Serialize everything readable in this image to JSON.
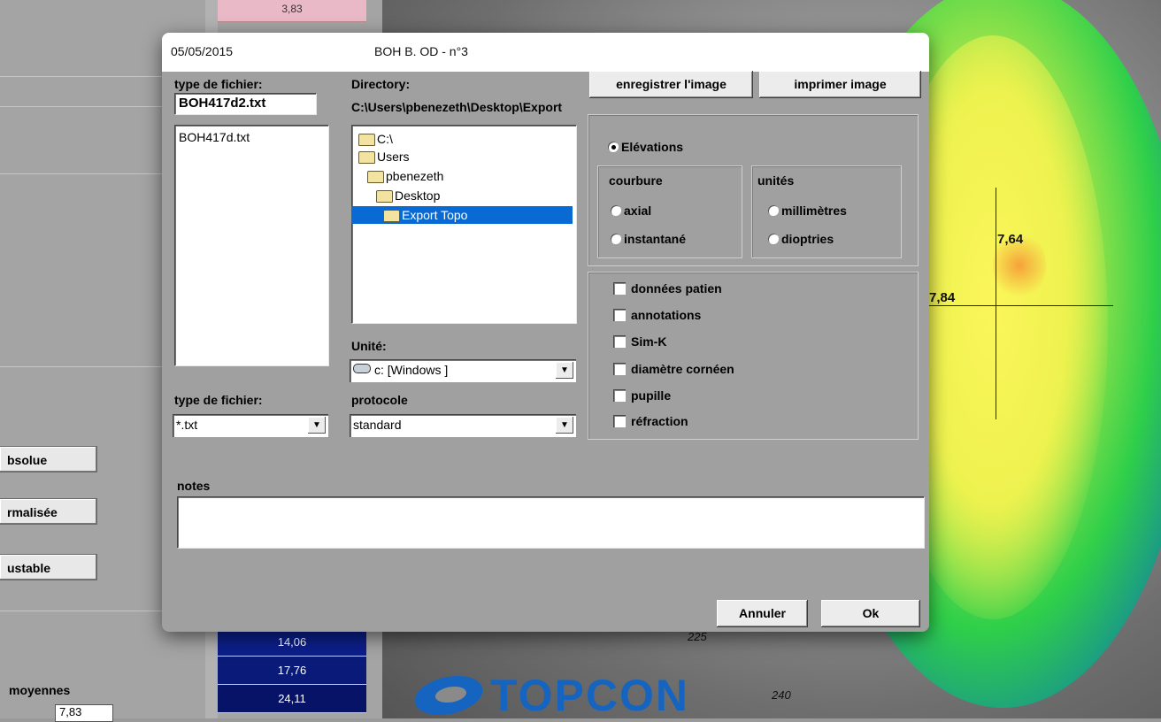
{
  "background": {
    "top_value": "3,83",
    "left_buttons": [
      "bsolue",
      "rmalisée",
      "ustable"
    ],
    "value_cells": [
      {
        "text": "14,06",
        "color": "#0c1f8a"
      },
      {
        "text": "17,76",
        "color": "#0a1a78"
      },
      {
        "text": "24,11",
        "color": "#071366"
      }
    ],
    "moyennes_label": "moyennes",
    "moyennes_value": "7,83",
    "map_values": {
      "upper": "7,64",
      "left": "7,84"
    },
    "compass_labels": {
      "a": "225",
      "b": "240"
    },
    "logo_text": "TOPCON",
    "logo_color": "#1565c0"
  },
  "dialog": {
    "title_date": "05/05/2015",
    "title_patient": "BOH B. OD - n°3",
    "file_name_label": "type de fichier:",
    "file_name_value": "BOH417d2.txt",
    "file_list": [
      "BOH417d.txt"
    ],
    "directory_label": "Directory:",
    "directory_path": "C:\\Users\\pbenezeth\\Desktop\\Export",
    "tree": [
      {
        "label": "C:\\",
        "selected": false
      },
      {
        "label": "Users",
        "selected": false
      },
      {
        "label": "pbenezeth",
        "selected": false
      },
      {
        "label": "Desktop",
        "selected": false
      },
      {
        "label": "Export Topo",
        "selected": true
      }
    ],
    "unit_label": "Unité:",
    "drive_value": "c: [Windows ]",
    "file_type_label": "type de fichier:",
    "file_type_value": "*.txt",
    "protocol_label": "protocole",
    "protocol_value": "standard",
    "save_button": "enregistrer l'image",
    "print_button": "imprimer image",
    "elevations_label": "Elévations",
    "curvature_label": "courbure",
    "axial_label": "axial",
    "instant_label": "instantané",
    "units_label": "unités",
    "mm_label": "millimètres",
    "diopters_label": "dioptries",
    "checkboxes": [
      "données patien",
      "annotations",
      "Sim-K",
      "diamètre cornéen",
      "pupille",
      "réfraction"
    ],
    "notes_label": "notes",
    "notes_value": "",
    "cancel_button": "Annuler",
    "ok_button": "Ok"
  }
}
